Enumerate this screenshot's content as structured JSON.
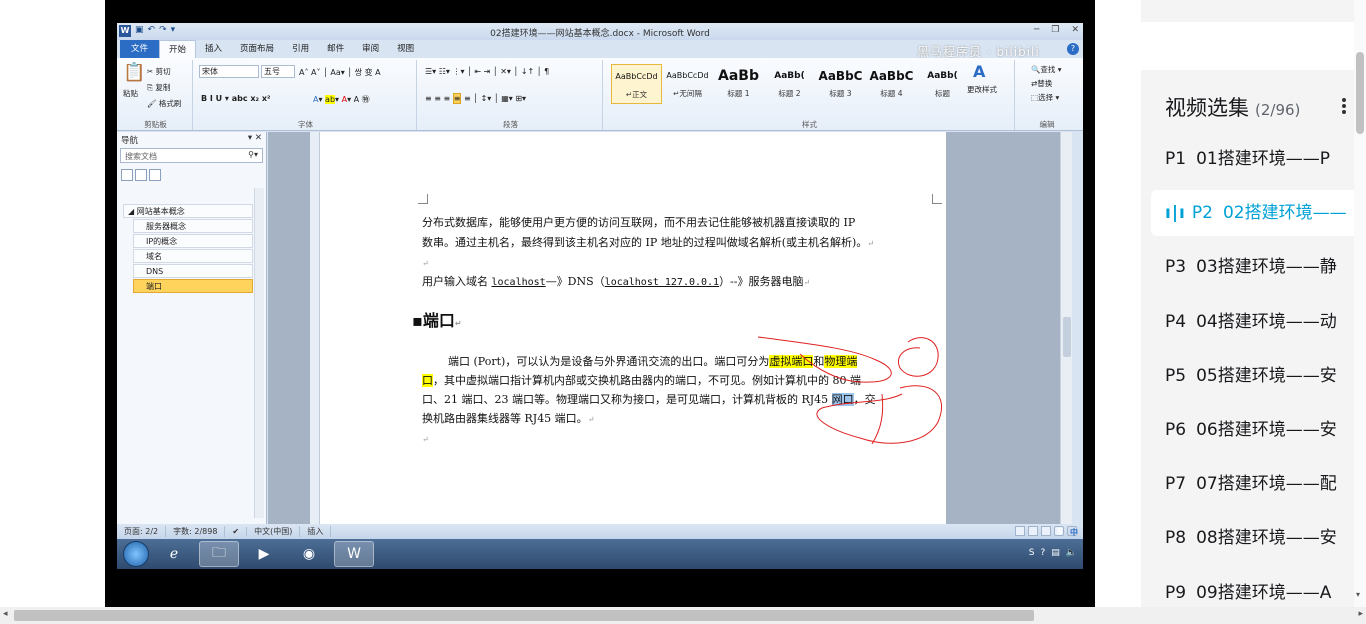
{
  "word": {
    "title": "02搭建环境——网站基本概念.docx - Microsoft Word",
    "tabs": [
      "文件",
      "开始",
      "插入",
      "页面布局",
      "引用",
      "邮件",
      "审阅",
      "视图"
    ],
    "watermark": "黑马程序员 · bilibili",
    "clipboard": {
      "paste": "粘贴",
      "cut": "剪切",
      "copy": "复制",
      "format_painter": "格式刷",
      "group": "剪贴板"
    },
    "font": {
      "name": "宋体",
      "size": "五号",
      "group": "字体"
    },
    "paragraph_group": "段落",
    "styles": {
      "group": "样式",
      "items": [
        {
          "preview": "AaBbCcDd",
          "name": "↵正文"
        },
        {
          "preview": "AaBbCcDd",
          "name": "↵无间隔"
        },
        {
          "preview": "AaBb",
          "name": "标题 1"
        },
        {
          "preview": "AaBb(",
          "name": "标题 2"
        },
        {
          "preview": "AaBbC",
          "name": "标题 3"
        },
        {
          "preview": "AaBbC",
          "name": "标题 4"
        },
        {
          "preview": "AaBb(",
          "name": "标题"
        }
      ],
      "change": "更改样式"
    },
    "editing": {
      "find": "查找",
      "replace": "替换",
      "select": "选择",
      "group": "编辑"
    },
    "nav": {
      "title": "导航",
      "search_placeholder": "搜索文档",
      "tree": [
        {
          "label": "网站基本概念",
          "level": 0
        },
        {
          "label": "服务器概念",
          "level": 1
        },
        {
          "label": "IP的概念",
          "level": 1
        },
        {
          "label": "域名",
          "level": 1
        },
        {
          "label": "DNS",
          "level": 1
        },
        {
          "label": "端口",
          "level": 1,
          "selected": true
        }
      ]
    },
    "doc": {
      "line1": "分布式数据库，能够使用户更方便的访问互联网，而不用去记住能够被机器直接读取的 IP",
      "line2": "数串。通过主机名，最终得到该主机名对应的 IP 地址的过程叫做域名解析(或主机名解析)。",
      "line3_pre": "用户输入域名 ",
      "line3_code1": "localhost",
      "line3_mid": "—》DNS（",
      "line3_code2": "localhost  127.0.0.1",
      "line3_post": "）--》服务器电脑",
      "heading": "端口",
      "p1_a": "端口 (Port)，可以认为是设备与外界通讯交流的出口。端口可分为",
      "p1_hl1": "虚拟端口",
      "p1_and": "和",
      "p1_hl2": "物理端",
      "p2_hl": "口",
      "p2_rest": "，其中虚拟端口指计算机内部或交换机路由器内的端口，不可见。例如计算机中的 80 端",
      "p3_a": "口、21 端口、23 端口等。物理端口又称为接口，是可见端口，计算机背板的 RJ45 ",
      "p3_sel": "网口",
      "p3_b": "，交",
      "p4": "换机路由器集线器等 RJ45 端口。"
    },
    "status": {
      "page": "页面: 2/2",
      "words": "字数: 2/898",
      "lang": "中文(中国)",
      "mode": "插入",
      "ime": "S",
      "ime_lang": "中"
    }
  },
  "playlist": {
    "title": "视频选集",
    "count": "(2/96)",
    "items": [
      {
        "p": "P1",
        "title": "01搭建环境——P"
      },
      {
        "p": "P2",
        "title": "02搭建环境——",
        "active": true
      },
      {
        "p": "P3",
        "title": "03搭建环境——静"
      },
      {
        "p": "P4",
        "title": "04搭建环境——动"
      },
      {
        "p": "P5",
        "title": "05搭建环境——安"
      },
      {
        "p": "P6",
        "title": "06搭建环境——安"
      },
      {
        "p": "P7",
        "title": "07搭建环境——配"
      },
      {
        "p": "P8",
        "title": "08搭建环境——安"
      },
      {
        "p": "P9",
        "title": "09搭建环境——A"
      }
    ]
  },
  "colors": {
    "accent": "#00a1d6",
    "word_blue": "#2b6cc4",
    "highlight": "#ffff00",
    "ink": "#e02020"
  }
}
